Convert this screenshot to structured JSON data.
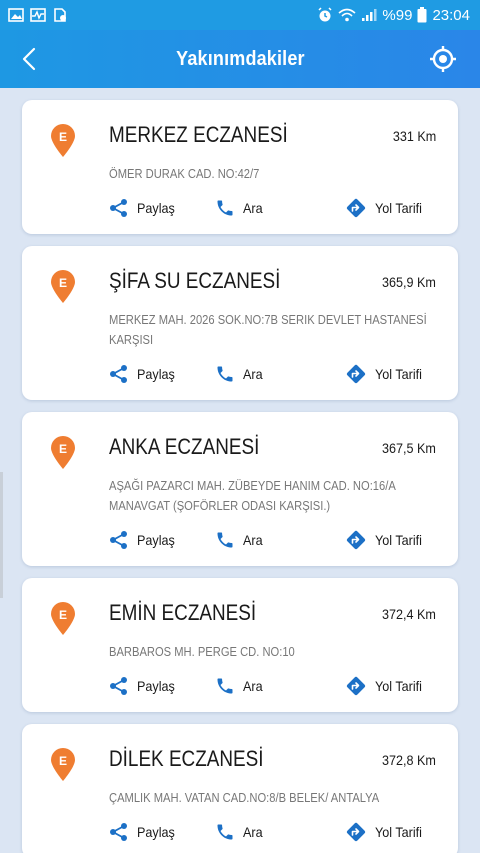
{
  "status_bar": {
    "battery": "%99",
    "time": "23:04",
    "left_icons": [
      "image-icon",
      "activity-icon",
      "file-icon"
    ],
    "right_icons": [
      "alarm-icon",
      "wifi-icon",
      "signal-icon",
      "battery-icon"
    ]
  },
  "header": {
    "title": "Yakınımdakiler",
    "back_icon": "chevron-left-icon",
    "locate_icon": "crosshair-icon"
  },
  "colors": {
    "header": "#1f9be3",
    "pin": "#ef7d31",
    "action_icon": "#1c70c6",
    "background": "#dbe5f3"
  },
  "actions": {
    "share": "Paylaş",
    "call": "Ara",
    "route": "Yol Tarifi"
  },
  "pharmacies": [
    {
      "letter": "E",
      "name": "MERKEZ ECZANESİ",
      "distance": "331 Km",
      "address": "ÖMER DURAK CAD. NO:42/7"
    },
    {
      "letter": "E",
      "name": "ŞİFA SU ECZANESİ",
      "distance": "365,9 Km",
      "address": "MERKEZ MAH. 2026 SOK.NO:7B SERIK  DEVLET HASTANESİ KARŞISI"
    },
    {
      "letter": "E",
      "name": "ANKA ECZANESİ",
      "distance": "367,5 Km",
      "address": "AŞAĞI PAZARCI MAH. ZÜBEYDE HANIM CAD. NO:16/A MANAVGAT (ŞOFÖRLER ODASI KARŞISI.)"
    },
    {
      "letter": "E",
      "name": "EMİN ECZANESİ",
      "distance": "372,4 Km",
      "address": "BARBAROS MH. PERGE CD. NO:10"
    },
    {
      "letter": "E",
      "name": "DİLEK ECZANESİ",
      "distance": "372,8 Km",
      "address": "ÇAMLIK MAH. VATAN CAD.NO:8/B BELEK/ ANTALYA"
    }
  ]
}
